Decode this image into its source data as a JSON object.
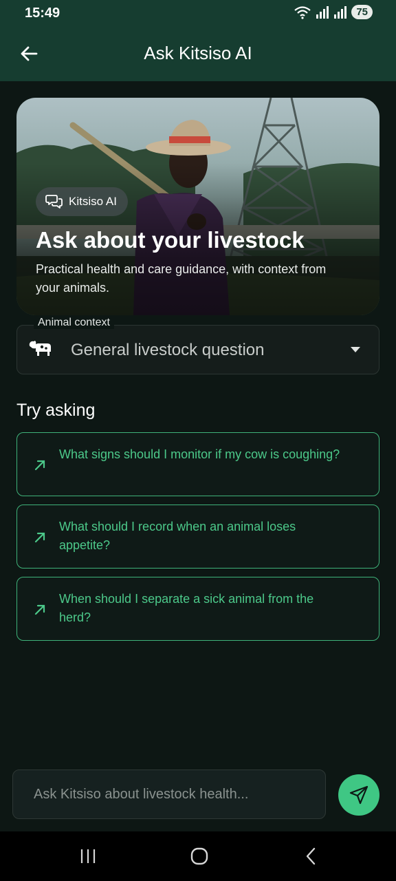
{
  "status_bar": {
    "time": "15:49",
    "battery": "75"
  },
  "app_bar": {
    "title": "Ask Kitsiso AI",
    "back_icon": "arrow-left-icon"
  },
  "hero": {
    "chip_label": "Kitsiso AI",
    "chip_icon": "chat-bubbles-icon",
    "title": "Ask about your livestock",
    "subtitle": "Practical health and care guidance, with context from your animals."
  },
  "animal_context": {
    "label": "Animal context",
    "value": "General livestock question",
    "icon": "cow-icon"
  },
  "suggestions": {
    "title": "Try asking",
    "items": [
      {
        "text": "What signs should I monitor if my cow is coughing?"
      },
      {
        "text": "What should I record when an animal loses appetite?"
      },
      {
        "text": "When should I separate a sick animal from the herd?"
      }
    ]
  },
  "composer": {
    "placeholder": "Ask Kitsiso about livestock health..."
  },
  "colors": {
    "appbar": "#163d30",
    "background": "#0d1714",
    "accent": "#3fc784",
    "suggestion_text": "#4cc98a"
  }
}
